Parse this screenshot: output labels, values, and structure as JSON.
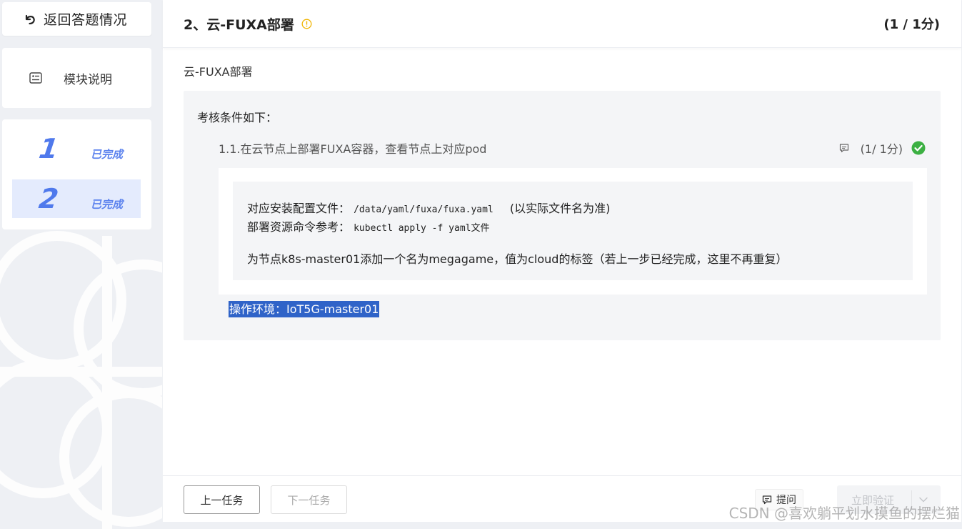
{
  "sidebar": {
    "back_label": "返回答题情况",
    "module_label": "模块说明",
    "tasks": [
      {
        "number": "1",
        "status": "已完成"
      },
      {
        "number": "2",
        "status": "已完成"
      }
    ]
  },
  "header": {
    "title": "2、云-FUXA部署",
    "score": "(1 / 1分)"
  },
  "content": {
    "subtitle": "云-FUXA部署",
    "cond_title": "考核条件如下：",
    "requirement": {
      "text": "1.1.在云节点上部署FUXA容器，查看节点上对应pod",
      "score": "(1/ 1分)"
    },
    "details": {
      "line1_label": "对应安装配置文件：",
      "line1_code": "/data/yaml/fuxa/fuxa.yaml",
      "line1_note": "(以实际文件名为准)",
      "line2_label": "部署资源命令参考：",
      "line2_code": "kubectl apply -f yaml文件",
      "line3": "为节点k8s-master01添加一个名为megagame，值为cloud的标签（若上一步已经完成，这里不再重复）"
    },
    "env": "操作环境：IoT5G-master01"
  },
  "footer": {
    "prev_label": "上一任务",
    "next_label": "下一任务",
    "hint_label": "提问",
    "verify_label": "立即验证"
  },
  "watermark": "CSDN @喜欢躺平划水摸鱼的摆烂猫",
  "colors": {
    "accent": "#4f79ec",
    "success": "#3cb043",
    "warning": "#f0b400",
    "selection": "#2f63c8"
  }
}
